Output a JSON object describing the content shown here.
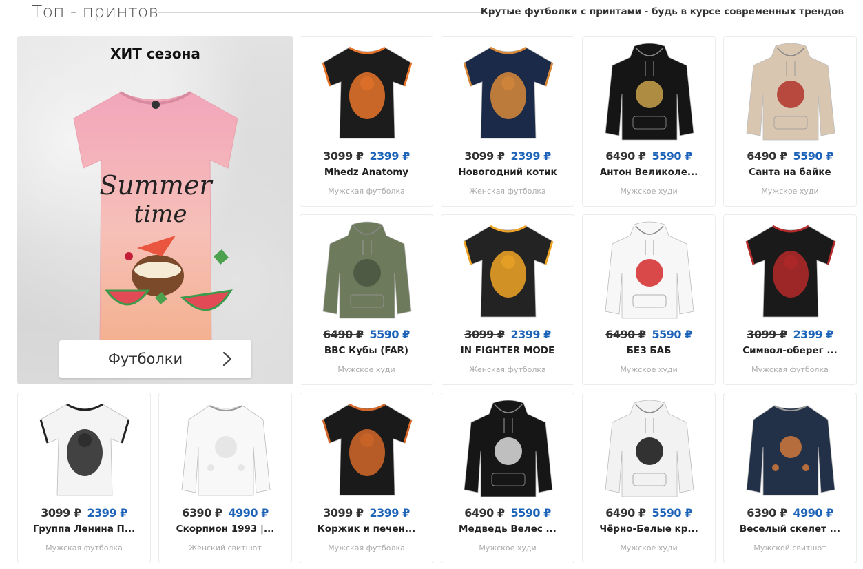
{
  "header": {
    "title": "Топ - принтов",
    "subtitle": "Крутые футболки с принтами - будь в курсе современных трендов"
  },
  "feature": {
    "hit_label": "ХИТ сезона",
    "shirt_text_1": "Summer",
    "shirt_text_2": "time",
    "category_button": "Футболки"
  },
  "products": [
    {
      "old": "3099 ₽",
      "new": "2399 ₽",
      "name": "Mhedz Anatomy",
      "type": "Мужская футболка",
      "kind": "tshirt",
      "color": "#1c1c1c",
      "accent": "#e8742a",
      "icon": "muscle-anatomy-print"
    },
    {
      "old": "3099 ₽",
      "new": "2399 ₽",
      "name": "Новогодний котик",
      "type": "Женская футболка",
      "kind": "tshirt",
      "color": "#1b2a48",
      "accent": "#d8893a",
      "icon": "christmas-cat-print"
    },
    {
      "old": "6490 ₽",
      "new": "5590 ₽",
      "name": "Антон Великоле...",
      "type": "Мужское худи",
      "kind": "hoodie",
      "color": "#151515",
      "accent": "#c9a24a",
      "icon": "gold-crest-print"
    },
    {
      "old": "6490 ₽",
      "new": "5590 ₽",
      "name": "Санта на байке",
      "type": "Мужское худи",
      "kind": "hoodie",
      "color": "#d9c6b0",
      "accent": "#b0322a",
      "icon": "santa-bike-print"
    },
    {
      "old": "6490 ₽",
      "new": "5590 ₽",
      "name": "BBC Кубы (FAR)",
      "type": "Мужское худи",
      "kind": "hoodie",
      "color": "#6d7a5c",
      "accent": "#4a5540",
      "icon": "military-patch-print"
    },
    {
      "old": "3099 ₽",
      "new": "2399 ₽",
      "name": "IN FIGHTER MODE",
      "type": "Женская футболка",
      "kind": "tshirt",
      "color": "#232323",
      "accent": "#f0a526",
      "icon": "gorilla-print"
    },
    {
      "old": "6490 ₽",
      "new": "5590 ₽",
      "name": "БЕЗ БАБ",
      "type": "Мужское худи",
      "kind": "hoodie",
      "color": "#f7f7f7",
      "accent": "#d42a2a",
      "icon": "no-sign-print"
    },
    {
      "old": "3099 ₽",
      "new": "2399 ₽",
      "name": "Символ-оберег ...",
      "type": "Мужская футболка",
      "kind": "tshirt",
      "color": "#1a1a1a",
      "accent": "#b52a2a",
      "icon": "slavic-symbol-print"
    },
    {
      "old": "3099 ₽",
      "new": "2399 ₽",
      "name": "Группа Ленина П...",
      "type": "Мужская футболка",
      "kind": "tshirt",
      "color": "#f4f4f4",
      "accent": "#222222",
      "icon": "lenin-print"
    },
    {
      "old": "6390 ₽",
      "new": "4990 ₽",
      "name": "Скорпион 1993 |...",
      "type": "Женский свитшот",
      "kind": "sweatshirt",
      "color": "#f8f8f8",
      "accent": "#e0e0e0",
      "icon": "plain-white-print"
    },
    {
      "old": "3099 ₽",
      "new": "2399 ₽",
      "name": "Коржик и печен...",
      "type": "Мужская футболка",
      "kind": "tshirt",
      "color": "#1a1a1a",
      "accent": "#d4682a",
      "icon": "scream-painting-print"
    },
    {
      "old": "6490 ₽",
      "new": "5590 ₽",
      "name": "Медведь Велес ...",
      "type": "Мужское худи",
      "kind": "hoodie",
      "color": "#161616",
      "accent": "#dddddd",
      "icon": "bear-print"
    },
    {
      "old": "6490 ₽",
      "new": "5590 ₽",
      "name": "Чёрно-Белые кр...",
      "type": "Мужское худи",
      "kind": "hoodie",
      "color": "#f2f2f2",
      "accent": "#111111",
      "icon": "brush-strokes-print"
    },
    {
      "old": "6390 ₽",
      "new": "4990 ₽",
      "name": "Веселый скелет ...",
      "type": "Мужской свитшот",
      "kind": "sweatshirt",
      "color": "#233148",
      "accent": "#e8823a",
      "icon": "skeleton-print"
    }
  ]
}
